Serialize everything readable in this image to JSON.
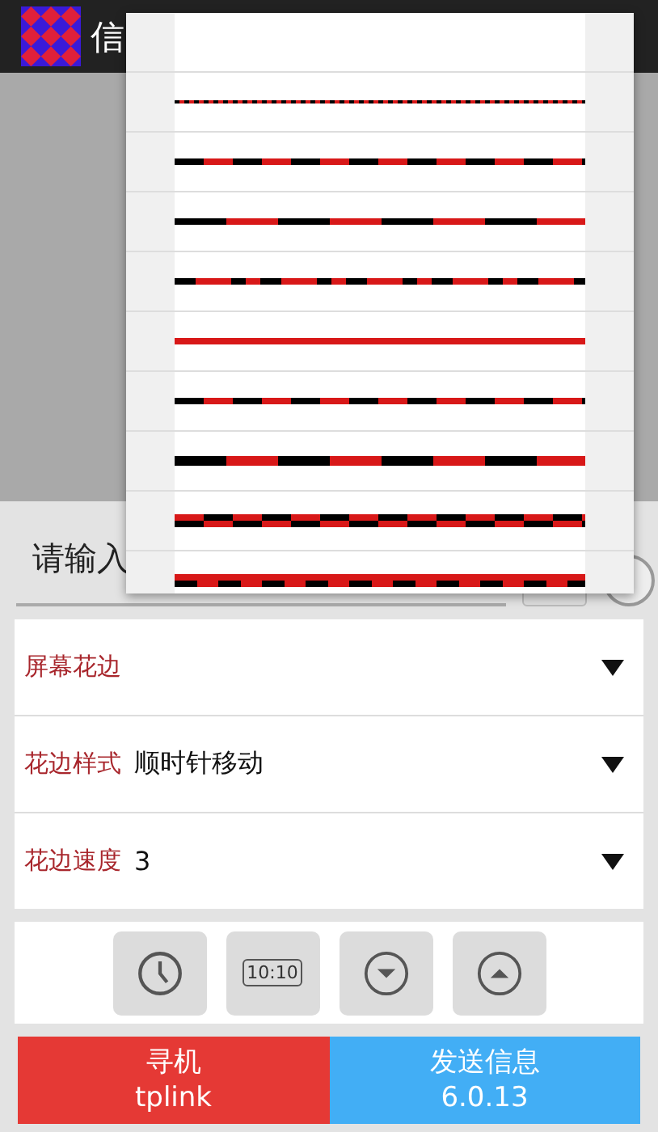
{
  "app_bar": {
    "title": "信"
  },
  "input": {
    "placeholder": "请输入"
  },
  "pattern_menu": {
    "options": [
      {
        "kind": "blank"
      },
      {
        "kind": "fine-dash"
      },
      {
        "kind": "dash"
      },
      {
        "kind": "long-dash"
      },
      {
        "kind": "mixed-dash"
      },
      {
        "kind": "solid"
      },
      {
        "kind": "dash"
      },
      {
        "kind": "thick-long-dash"
      },
      {
        "kind": "checker"
      },
      {
        "kind": "thick-checker"
      }
    ]
  },
  "settings": [
    {
      "label": "屏幕花边"
    },
    {
      "label": "花边样式",
      "value": "顺时针移动"
    },
    {
      "label": "花边速度",
      "value": "3"
    }
  ],
  "toolbar": {
    "buttons": [
      {
        "kind": "clock"
      },
      {
        "kind": "time-display",
        "text": "10:10"
      },
      {
        "kind": "down"
      },
      {
        "kind": "up"
      }
    ]
  },
  "actions": [
    {
      "title": "寻机",
      "subtitle": "tplink",
      "color": "#e53935"
    },
    {
      "title": "发送信息",
      "subtitle": "6.0.13",
      "color": "#42aef5"
    }
  ]
}
